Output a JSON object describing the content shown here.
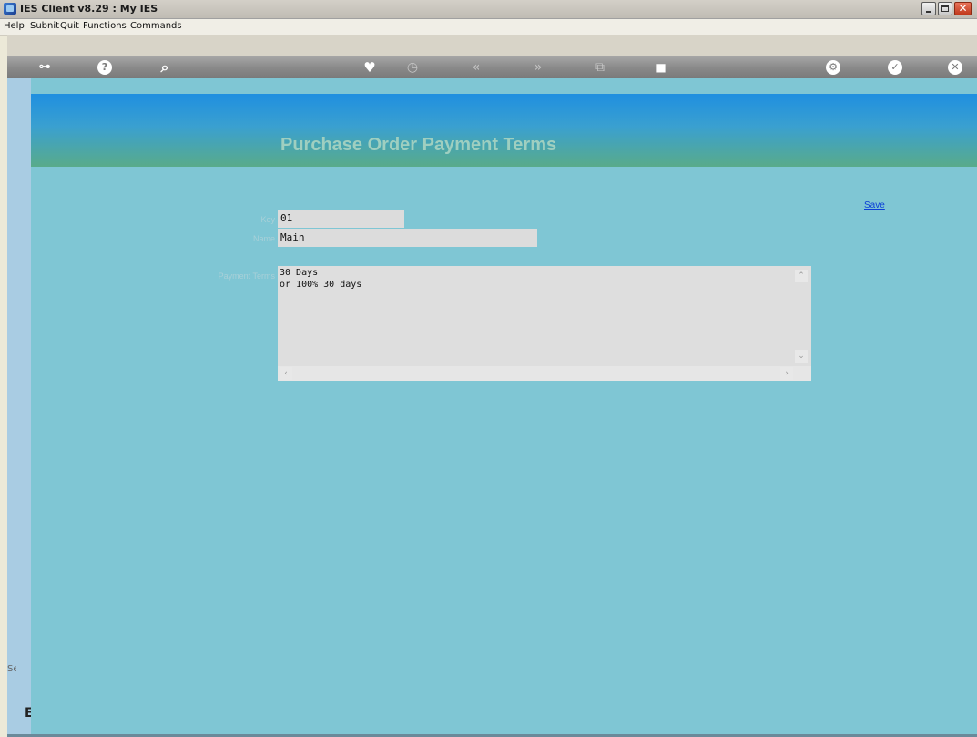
{
  "window": {
    "title": "IES Client v8.29 : My IES",
    "close_glyph": "✕"
  },
  "menu": {
    "items": [
      "Help",
      "Subnit",
      "Quit",
      "Functions",
      "Commands"
    ]
  },
  "toolbar": {
    "icons": [
      "key-icon",
      "help-icon",
      "search-icon",
      "heart-icon",
      "clock-icon",
      "rewind-icon",
      "fast-forward-icon",
      "copy-icon",
      "stop-icon",
      "settings-icon",
      "check-icon",
      "close-icon"
    ]
  },
  "header": {
    "title": "Purchase Order Payment Terms"
  },
  "form": {
    "key_label": "Key",
    "key_value": "01",
    "name_label": "Name",
    "name_value": "Main",
    "terms_label": "Payment Terms",
    "terms_lines": [
      "30 Days",
      "or 100% 30 days"
    ]
  },
  "actions": {
    "save_label": "Save"
  },
  "left_panel": {
    "label": "Se",
    "glyph": "E"
  },
  "colors": {
    "content_bg": "#7fc6d4",
    "banner_top": "#1f8fe0",
    "banner_bottom": "#59ab8a",
    "link": "#0b3fd6"
  }
}
